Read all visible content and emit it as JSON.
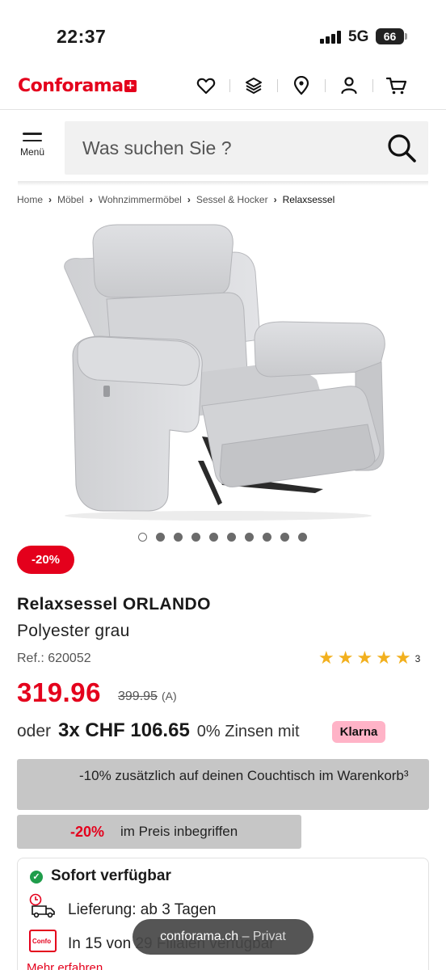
{
  "status": {
    "time": "22:37",
    "network": "5G",
    "battery": "66"
  },
  "brand": {
    "name": "Conforama",
    "accent": "#e4001c"
  },
  "nav_icons": [
    "heart-icon",
    "layers-icon",
    "location-pin-icon",
    "account-icon",
    "cart-icon"
  ],
  "search": {
    "menu_label": "Menü",
    "placeholder": "Was suchen Sie ?"
  },
  "breadcrumb": {
    "items": [
      "Home",
      "Möbel",
      "Wohnzimmermöbel",
      "Sessel & Hocker",
      "Relaxsessel"
    ]
  },
  "carousel": {
    "count": 10,
    "active": 0
  },
  "product": {
    "badge": "-20%",
    "title": "Relaxsessel ORLANDO",
    "subtitle": "Polyester grau",
    "ref": "Ref.: 620052",
    "rating_stars": 5,
    "rating_count": "3",
    "price": "319.96",
    "old_price": "399.95",
    "old_price_suffix": "(A)"
  },
  "installment": {
    "prefix": "oder",
    "amount": "3x CHF 106.65",
    "suffix": "0% Zinsen mit",
    "provider": "Klarna"
  },
  "promos": {
    "promo1": "-10% zusätzlich auf deinen Couchtisch im Warenkorb³",
    "promo2_pct": "-20%",
    "promo2_text": "im Preis inbegriffen"
  },
  "availability": {
    "title": "Sofort verfügbar",
    "delivery": "Lieferung: ab 3 Tagen",
    "store_label": "Confo",
    "store": "In 15 von 29 Filialen verfügbar",
    "more": "Mehr erfahren"
  },
  "browser": {
    "url": "conforama.ch",
    "mode": "– Privat"
  }
}
